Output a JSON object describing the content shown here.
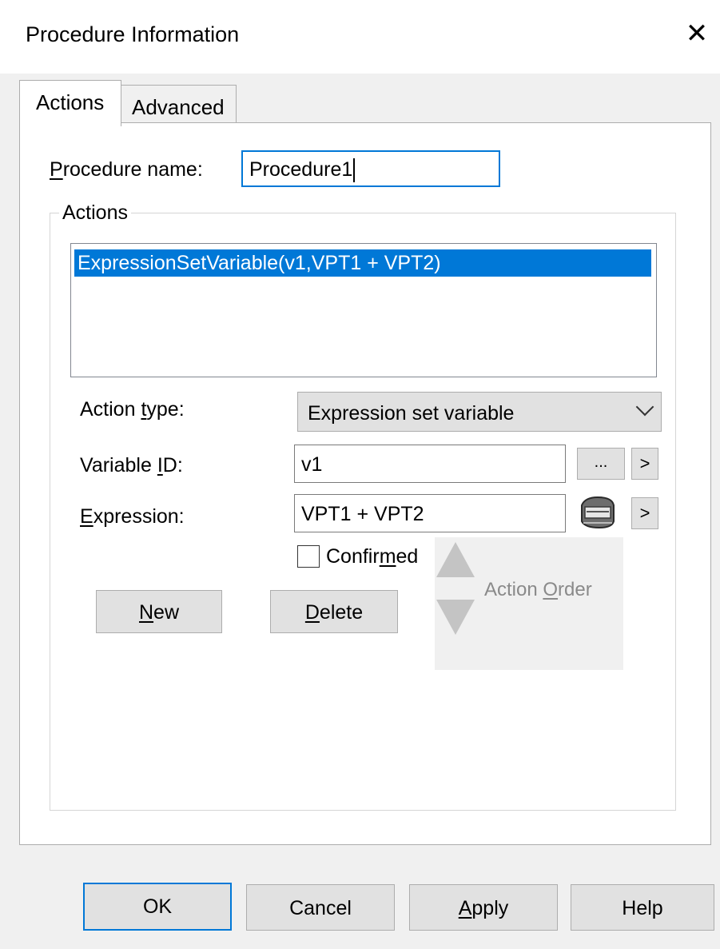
{
  "window": {
    "title": "Procedure Information",
    "close_glyph": "✕"
  },
  "tabs": [
    {
      "label": "Actions",
      "active": true
    },
    {
      "label": "Advanced",
      "active": false
    }
  ],
  "procedure": {
    "label_mnemonic": "P",
    "label_rest": "rocedure name:",
    "value": "Procedure1"
  },
  "actions_group": {
    "legend": "Actions",
    "list_items": [
      "ExpressionSetVariable(v1,VPT1 + VPT2)"
    ],
    "selected_index": 0
  },
  "action_type": {
    "label_before": "Action ",
    "label_mnemonic": "t",
    "label_after": "ype:",
    "selected": "Expression set variable"
  },
  "variable_id": {
    "label_before": "Variable ",
    "label_mnemonic": "I",
    "label_after": "D:",
    "value": "v1",
    "browse_label": "...",
    "arrow_label": ">"
  },
  "expression": {
    "label_mnemonic": "E",
    "label_rest": "xpression:",
    "value": "VPT1 + VPT2",
    "builder_icon": "expression-builder-icon",
    "arrow_label": ">"
  },
  "confirmed": {
    "label_before": "Confir",
    "label_mnemonic": "m",
    "label_after": "ed",
    "checked": false
  },
  "buttons": {
    "new_mnemonic": "N",
    "new_rest": "ew",
    "delete_mnemonic": "D",
    "delete_rest": "elete",
    "order_before": "Action ",
    "order_mnemonic": "O",
    "order_after": "rder"
  },
  "footer": {
    "ok": "OK",
    "cancel": "Cancel",
    "apply_mnemonic": "A",
    "apply_rest": "pply",
    "help": "Help"
  },
  "colors": {
    "accent": "#0078d7",
    "selection_text": "#ffffff",
    "disabled_text": "#8a8a8a"
  }
}
